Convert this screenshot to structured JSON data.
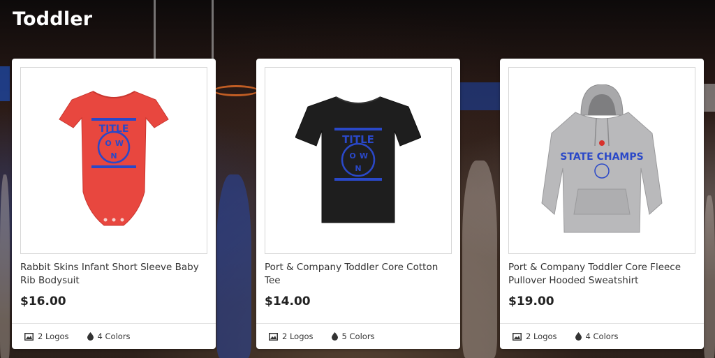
{
  "section": {
    "title": "Toddler"
  },
  "products": [
    {
      "name": "Rabbit Skins Infant Short Sleeve Baby Rib Bodysuit",
      "price": "$16.00",
      "logos": "2 Logos",
      "colors": "4 Colors",
      "garment_color": "#e8473f",
      "print": {
        "line1": "TITLE",
        "line2": "TOWN"
      }
    },
    {
      "name": "Port & Company Toddler Core Cotton Tee",
      "price": "$14.00",
      "logos": "2 Logos",
      "colors": "5 Colors",
      "garment_color": "#1e1e1e",
      "print": {
        "line1": "TITLE",
        "line2": "TOWN"
      }
    },
    {
      "name": "Port & Company Toddler Core Fleece Pullover Hooded Sweatshirt",
      "price": "$19.00",
      "logos": "2 Logos",
      "colors": "4 Colors",
      "garment_color": "#b9b9bb",
      "print": {
        "line1": "STATE CHAMPS",
        "line2": ""
      }
    }
  ],
  "icons": {
    "logos": "image-icon",
    "colors": "drop-icon"
  },
  "colors": {
    "print_blue": "#2a48c8",
    "print_red": "#d8322c"
  }
}
